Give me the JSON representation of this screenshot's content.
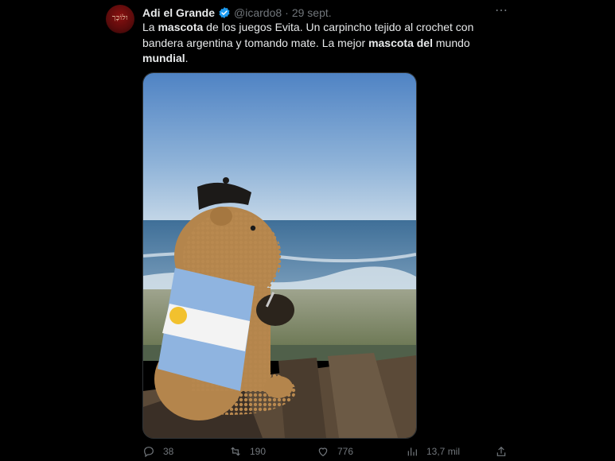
{
  "tweet": {
    "author_name": "Adi el Grande",
    "handle": "@icardo8",
    "separator": "·",
    "date": "29 sept.",
    "avatar_text": "ולוֹכָּך",
    "text_parts": {
      "p1": "La ",
      "b1": "mascota",
      "p2": " de los juegos Evita. Un carpincho tejido al crochet con bandera argentina y tomando mate. La mejor ",
      "b2": "mascota del",
      "p3": " mundo ",
      "b3": "mundial",
      "p4": "."
    },
    "more_icon": "⋯"
  },
  "actions": {
    "replies": "38",
    "retweets": "190",
    "likes": "776",
    "views": "13,7 mil"
  },
  "icons": {
    "reply": "reply-icon",
    "retweet": "retweet-icon",
    "like": "heart-icon",
    "views": "bar-chart-icon",
    "share": "share-icon",
    "verified": "verified-badge-icon"
  },
  "colors": {
    "background": "#000000",
    "text": "#e7e9ea",
    "muted": "#71767b",
    "verified": "#1d9bf0"
  }
}
